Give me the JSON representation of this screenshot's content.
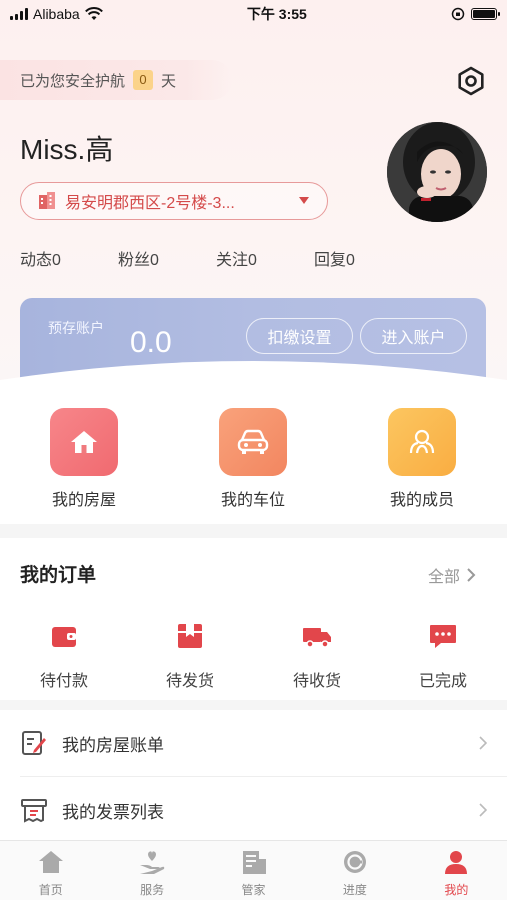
{
  "status_bar": {
    "carrier": "Alibaba",
    "time": "下午 3:55"
  },
  "header": {
    "safe_prefix": "已为您安全护航",
    "safe_days": "0",
    "safe_suffix": "天",
    "user_name": "Miss.高",
    "address": "易安明郡西区-2号楼-3...",
    "icons": {
      "settings": "settings-hexagon-icon",
      "building": "building-icon"
    }
  },
  "stats": [
    {
      "label": "动态",
      "value": "0"
    },
    {
      "label": "粉丝",
      "value": "0"
    },
    {
      "label": "关注",
      "value": "0"
    },
    {
      "label": "回复",
      "value": "0"
    }
  ],
  "account": {
    "label": "预存账户",
    "balance": "0.0",
    "deduct_settings": "扣缴设置",
    "enter_account": "进入账户"
  },
  "quick_links": [
    {
      "label": "我的房屋",
      "icon": "house-icon",
      "color": "#f07a7e"
    },
    {
      "label": "我的车位",
      "icon": "car-icon",
      "color": "#f59a6f"
    },
    {
      "label": "我的成员",
      "icon": "members-icon",
      "color": "#fbb74c"
    }
  ],
  "orders": {
    "title": "我的订单",
    "all": "全部",
    "items": [
      {
        "label": "待付款",
        "icon": "wallet-icon"
      },
      {
        "label": "待发货",
        "icon": "package-icon"
      },
      {
        "label": "待收货",
        "icon": "truck-icon"
      },
      {
        "label": "已完成",
        "icon": "chat-done-icon"
      }
    ]
  },
  "menu": [
    {
      "label": "我的房屋账单",
      "icon": "bill-edit-icon"
    },
    {
      "label": "我的发票列表",
      "icon": "invoice-icon"
    }
  ],
  "tabs": [
    {
      "label": "首页",
      "icon": "home-icon"
    },
    {
      "label": "服务",
      "icon": "service-hand-icon"
    },
    {
      "label": "管家",
      "icon": "butler-icon"
    },
    {
      "label": "进度",
      "icon": "progress-icon"
    },
    {
      "label": "我的",
      "icon": "user-icon",
      "active": true
    }
  ],
  "colors": {
    "accent": "#e2464b",
    "card": "#aab6de"
  }
}
